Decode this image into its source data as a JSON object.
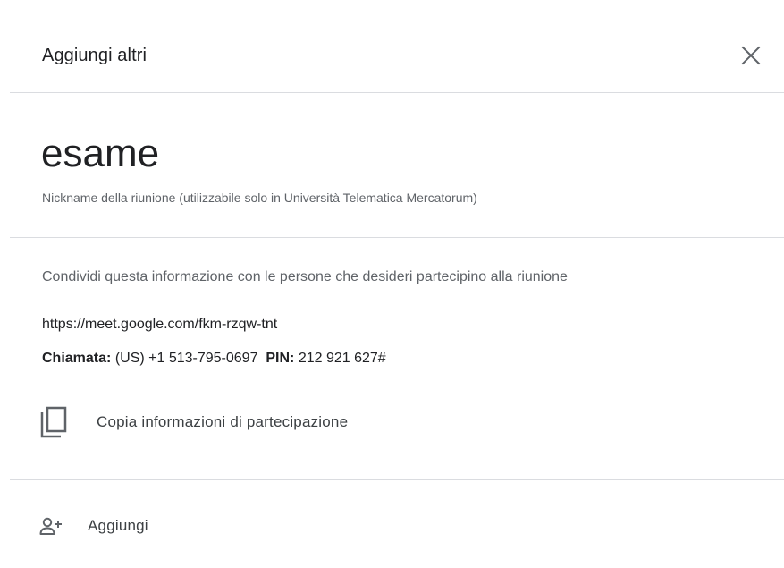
{
  "dialog": {
    "title": "Aggiungi altri",
    "close_icon": "close-icon"
  },
  "meeting": {
    "nickname": "esame",
    "nickname_caption": "Nickname della riunione (utilizzabile solo in Università Telematica Mercatorum)"
  },
  "share": {
    "hint": "Condividi questa informazione con le persone che desideri partecipino alla riunione",
    "link": "https://meet.google.com/fkm-rzqw-tnt",
    "dial_label": "Chiamata:",
    "dial_number": "(US) +1 513-795-0697",
    "pin_label": "PIN:",
    "pin_value": "212 921 627#"
  },
  "actions": {
    "copy_label": "Copia informazioni di partecipazione",
    "copy_icon": "copy-icon",
    "add_label": "Aggiungi",
    "add_icon": "person-add-icon"
  },
  "colors": {
    "primary_text": "#202124",
    "secondary_text": "#5f6368",
    "divider": "#dadce0",
    "icon": "#5f6368"
  }
}
